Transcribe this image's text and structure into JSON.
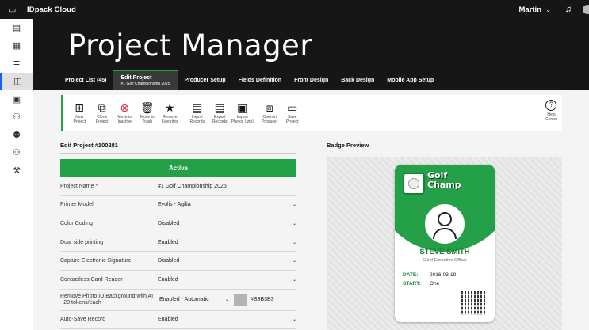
{
  "app": {
    "name": "IDpack Cloud",
    "user": "Martin"
  },
  "page_title": "Project Manager",
  "tabs": [
    {
      "label": "Project List (45)"
    },
    {
      "label": "Edit Project",
      "sublabel": "#1 Golf Championship 2025"
    },
    {
      "label": "Producer Setup"
    },
    {
      "label": "Fields Definition"
    },
    {
      "label": "Front Design"
    },
    {
      "label": "Back Design"
    },
    {
      "label": "Mobile App Setup"
    }
  ],
  "toolbar": [
    {
      "icon": "new-project-icon",
      "l1": "New",
      "l2": "Project"
    },
    {
      "icon": "clone-project-icon",
      "l1": "Clone",
      "l2": "Project"
    },
    {
      "icon": "inactive-icon",
      "l1": "Move to",
      "l2": "Inactive"
    },
    {
      "icon": "trash-icon",
      "l1": "Move to",
      "l2": "Trash"
    },
    {
      "icon": "star-icon",
      "l1": "Remove",
      "l2": "Favorites"
    },
    {
      "icon": "import-records-icon",
      "l1": "Import",
      "l2": "Records"
    },
    {
      "icon": "export-records-icon",
      "l1": "Export",
      "l2": "Records"
    },
    {
      "icon": "import-photos-icon",
      "l1": "Import",
      "l2": "Photos (.zip)"
    },
    {
      "icon": "open-producer-icon",
      "l1": "Open in",
      "l2": "Producer"
    },
    {
      "icon": "save-icon",
      "l1": "Save",
      "l2": "Project"
    }
  ],
  "help": {
    "l1": "Help",
    "l2": "Center"
  },
  "form": {
    "title": "Edit Project #100281",
    "status": "Active",
    "fields": [
      {
        "label": "Project Name",
        "required": "*",
        "value": "#1 Golf Championship 2025"
      },
      {
        "label": "Printer Model",
        "value": "Evolis - Agilia"
      },
      {
        "label": "Color Coding",
        "value": "Disabled"
      },
      {
        "label": "Dual side printing",
        "value": "Enabled"
      },
      {
        "label": "Capture Electronic Signature",
        "value": "Disabled"
      },
      {
        "label": "Contactless Card Reader",
        "value": "Enabled"
      }
    ],
    "bg": {
      "label": "Remove Photo ID Background with AI - 20 tokens/each",
      "value": "Enabled - Automatic",
      "color": "#B3B3B3"
    },
    "autosave": {
      "label": "Auto-Save Record",
      "value": "Enabled"
    }
  },
  "badge": {
    "title": "Badge Preview",
    "brand_l1": "Golf",
    "brand_l2": "Champ",
    "name": "STEVE SMITH",
    "role": "Chief Executive Officer",
    "date_label": "DATE:",
    "date_value": "2016-03-19",
    "start_label": "START:",
    "start_value": "One"
  }
}
